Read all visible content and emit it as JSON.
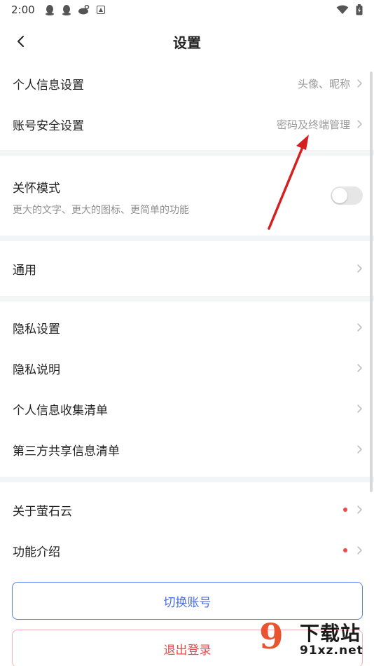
{
  "status_bar": {
    "time": "2:00",
    "left_icons": [
      "qq-icon",
      "qq-icon",
      "weibo-icon",
      "notification-icon"
    ],
    "right_icons": [
      "wifi-icon",
      "battery-icon"
    ]
  },
  "header": {
    "title": "设置"
  },
  "sections": {
    "account": [
      {
        "label": "个人信息设置",
        "value": "头像、昵称"
      },
      {
        "label": "账号安全设置",
        "value": "密码及终端管理"
      }
    ],
    "care": {
      "title": "关怀模式",
      "desc": "更大的文字、更大的图标、更简单的功能",
      "toggle_on": false
    },
    "general": [
      {
        "label": "通用"
      }
    ],
    "privacy": [
      {
        "label": "隐私设置"
      },
      {
        "label": "隐私说明"
      },
      {
        "label": "个人信息收集清单"
      },
      {
        "label": "第三方共享信息清单"
      }
    ],
    "about": [
      {
        "label": "关于萤石云",
        "badge": true
      },
      {
        "label": "功能介绍",
        "badge": true
      }
    ]
  },
  "buttons": {
    "switch_account": "切换账号",
    "logout": "退出登录"
  },
  "watermark": {
    "mark": "9",
    "text": "下载站",
    "url": "91xz.net"
  },
  "colors": {
    "accent_blue": "#4a6ef0",
    "danger_red": "#e84a4a",
    "badge_red": "#f04848",
    "arrow_red": "#d42020"
  }
}
